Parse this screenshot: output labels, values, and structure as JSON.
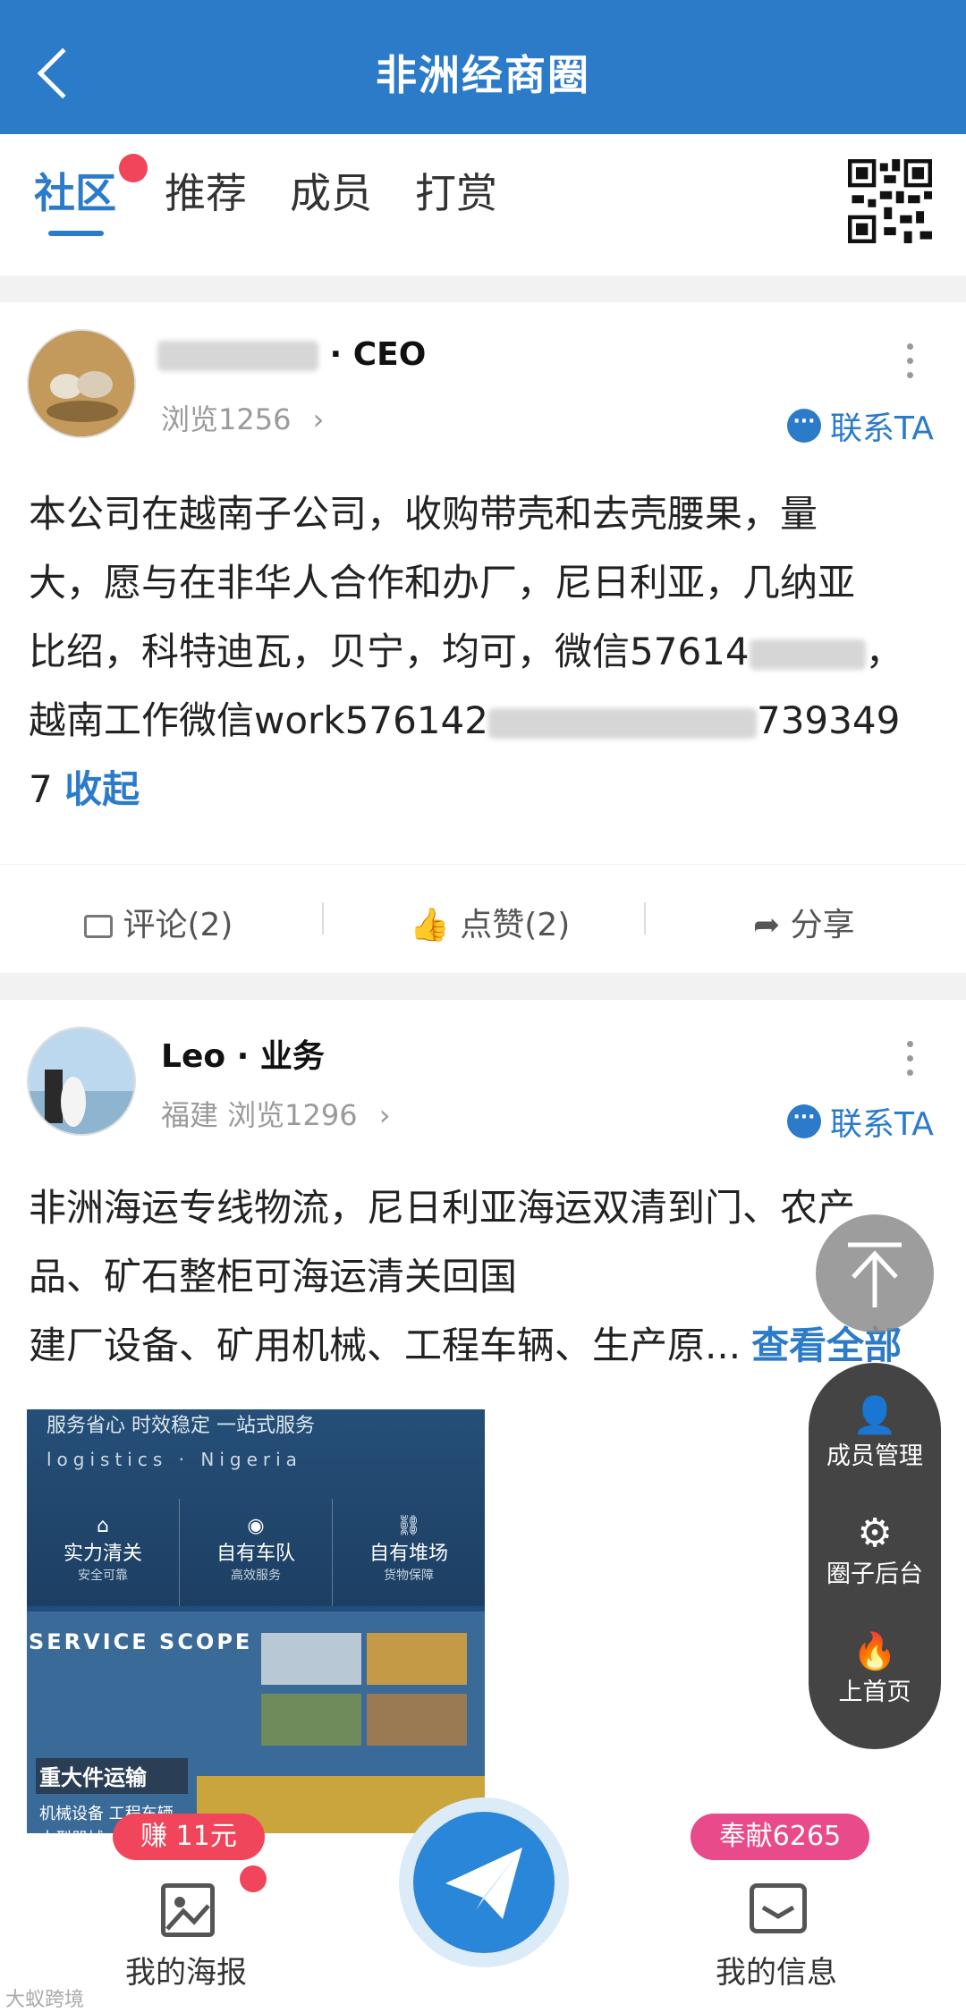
{
  "header": {
    "title": "非洲经商圈"
  },
  "tabs": [
    {
      "label": "社区",
      "active": true
    },
    {
      "label": "推荐"
    },
    {
      "label": "成员"
    },
    {
      "label": "打赏"
    }
  ],
  "posts": [
    {
      "author_suffix": "· CEO",
      "meta": "浏览1256",
      "contact": "联系TA",
      "text_lines": [
        "本公司在越南子公司，收购带壳和去壳腰果，量",
        "大，愿与在非华人合作和办厂，尼日利亚，几纳亚",
        "比绍，科特迪瓦，贝宁，均可，微信57614",
        "越南工作微信work576142"
      ],
      "line3_tail": "，",
      "line4_tail": "739349",
      "line5": "7",
      "collapse": "收起",
      "comment": "评论(2)",
      "like": "点赞(2)",
      "share": "分享"
    },
    {
      "author": "Leo · 业务",
      "meta": "福建  浏览1296",
      "contact": "联系TA",
      "text_lines": [
        "非洲海运专线物流，尼日利亚海运双清到门、农产",
        "品、矿石整柜可海运清关回国",
        "建厂设备、矿用机械、工程车辆、生产原..."
      ],
      "more_link": "查看全部",
      "poster": {
        "top_text": "服务省心 时效稳定 一站式服务",
        "subtitle": "logistics · Nigeria",
        "features": [
          {
            "title": "实力清关",
            "sub": "安全可靠"
          },
          {
            "title": "自有车队",
            "sub": "高效服务"
          },
          {
            "title": "自有堆场",
            "sub": "货物保障"
          }
        ],
        "scope": "SERVICE SCOPE",
        "heavy": "重大件运输",
        "heavy_items": "机械设备  工程车辆",
        "heavy_items2": "大型器械"
      }
    }
  ],
  "float_panel": {
    "members": "成员管理",
    "backend": "圈子后台",
    "home": "上首页"
  },
  "bottom_bar": {
    "poster_label": "我的海报",
    "poster_badge": "赚 11元",
    "info_label": "我的信息",
    "info_badge": "奉献6265"
  },
  "watermark": "大蚁跨境"
}
